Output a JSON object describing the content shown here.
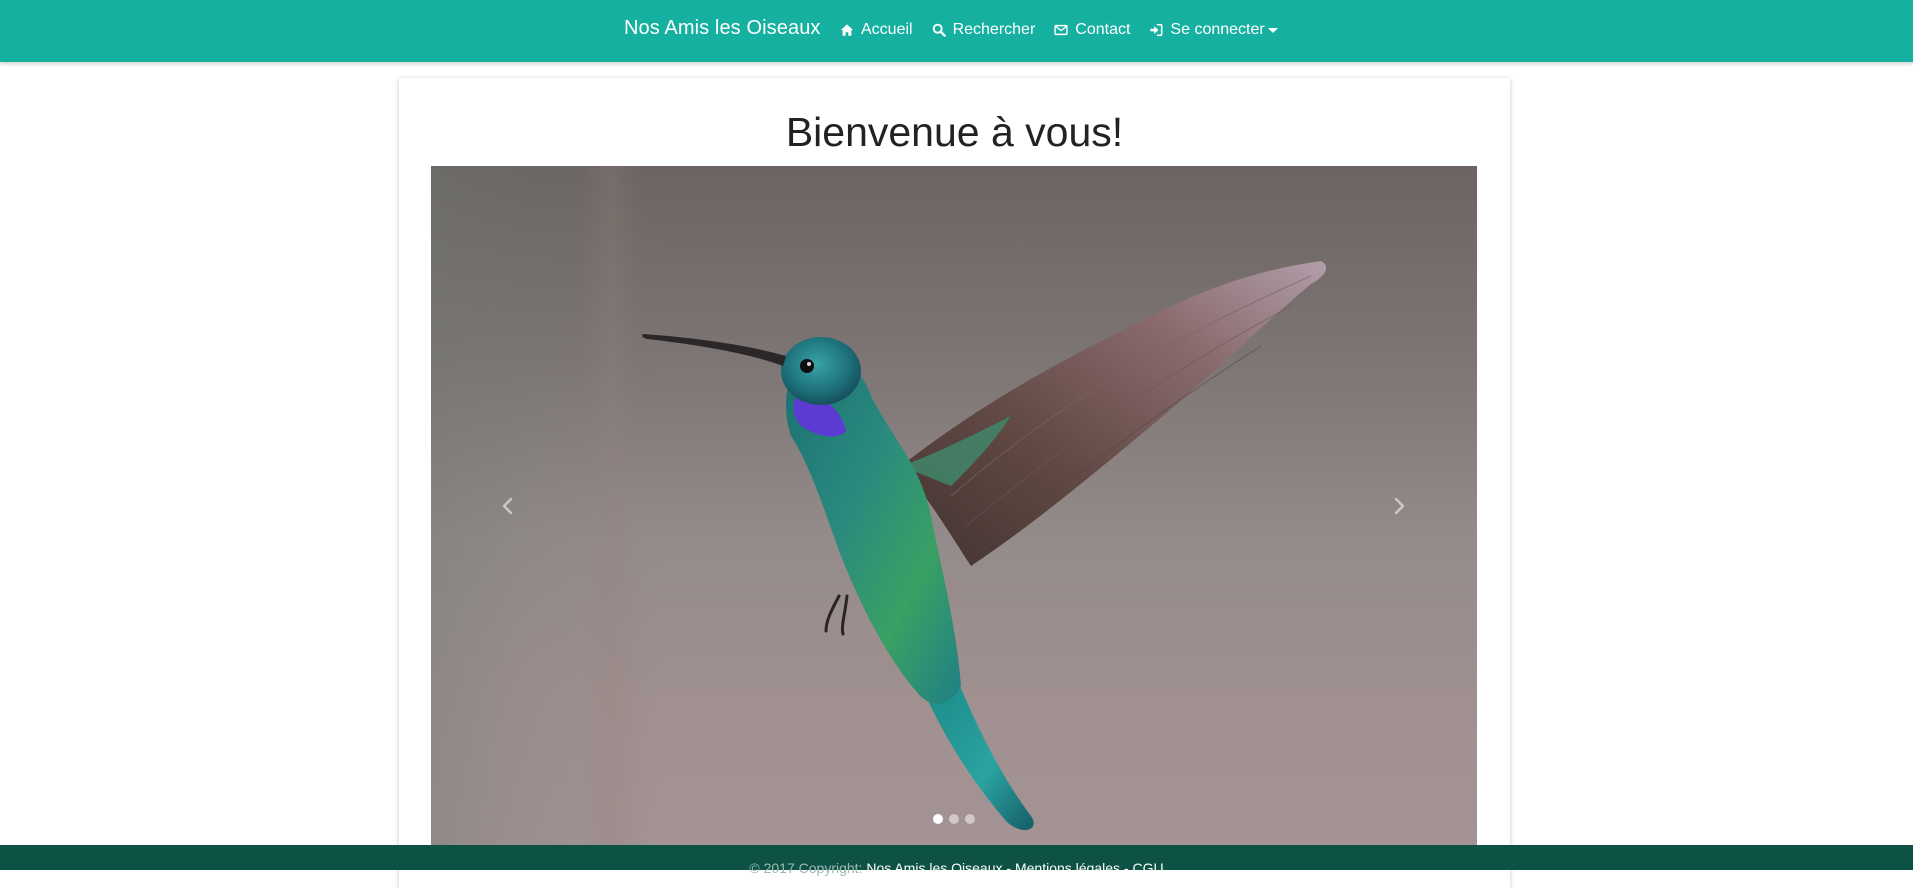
{
  "navbar": {
    "brand": "Nos Amis les Oiseaux",
    "items": [
      {
        "label": "Accueil",
        "icon": "home-icon"
      },
      {
        "label": "Rechercher",
        "icon": "search-icon"
      },
      {
        "label": "Contact",
        "icon": "envelope-icon"
      },
      {
        "label": "Se connecter",
        "icon": "sign-in-icon",
        "dropdown": true
      }
    ],
    "colors": {
      "background": "#15b09f",
      "text": "#ffffff"
    }
  },
  "main": {
    "title": "Bienvenue à vous!",
    "carousel": {
      "slide_image": "hummingbird",
      "slide_count": 3,
      "active_index": 0,
      "prev_icon": "chevron-left-icon",
      "next_icon": "chevron-right-icon"
    }
  },
  "footer": {
    "copyright": "© 2017 Copyright:",
    "site_link": "Nos Amis les Oiseaux",
    "separator": "-",
    "legal_link": "Mentions légales",
    "cgu_link": "CGU",
    "colors": {
      "background": "#0e5246"
    }
  }
}
